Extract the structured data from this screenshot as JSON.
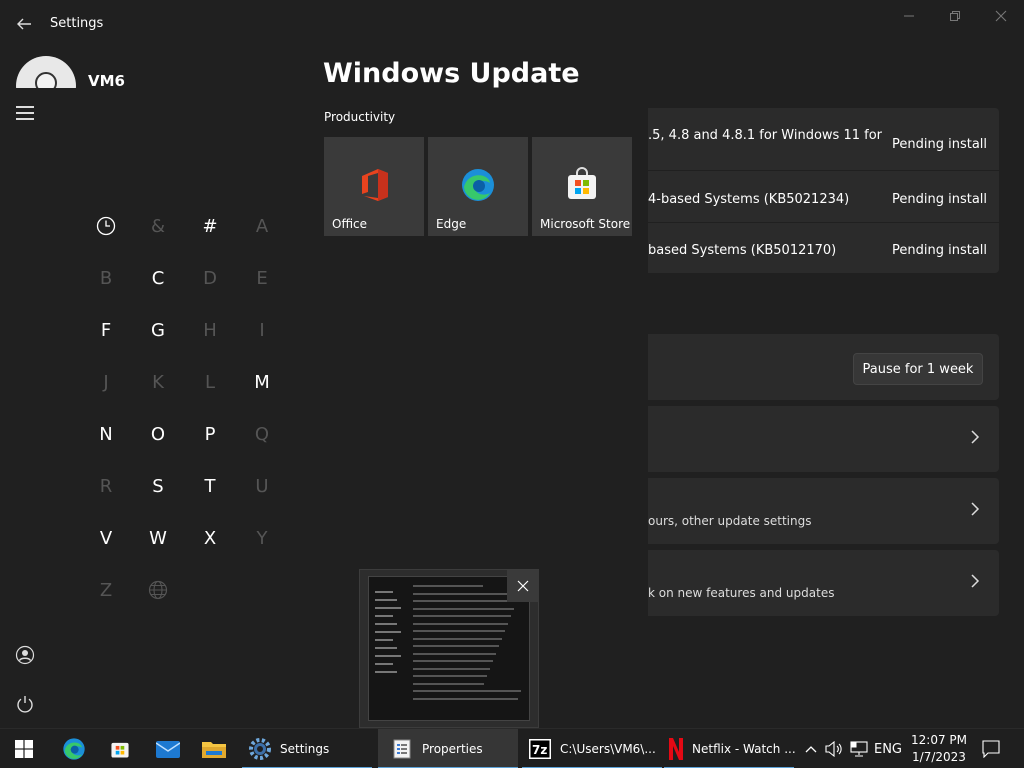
{
  "window": {
    "title": "Settings",
    "back_icon": "back-arrow-icon",
    "controls": [
      "minimize-icon",
      "maximize-icon",
      "close-icon"
    ]
  },
  "profile": {
    "name": "VM6"
  },
  "page": {
    "title": "Windows Update"
  },
  "updates": [
    {
      "name": ".5, 4.8 and 4.8.1 for Windows 11 for",
      "status": "Pending install"
    },
    {
      "name": "4-based Systems (KB5021234)",
      "status": "Pending install"
    },
    {
      "name": "based Systems (KB5012170)",
      "status": "Pending install"
    }
  ],
  "pause": {
    "label": "Pause for 1 week"
  },
  "cards": [
    {
      "subtitle": ""
    },
    {
      "subtitle": "ours, other update settings"
    },
    {
      "subtitle": "k on new features and updates"
    }
  ],
  "start_menu": {
    "group_label": "Productivity",
    "tiles": [
      {
        "label": "Office",
        "icon": "office-icon"
      },
      {
        "label": "Edge",
        "icon": "edge-icon"
      },
      {
        "label": "Microsoft Store",
        "icon": "microsoft-store-icon"
      }
    ],
    "letters": [
      {
        "c": "clock",
        "on": true
      },
      {
        "c": "&",
        "on": false
      },
      {
        "c": "#",
        "on": true
      },
      {
        "c": "A",
        "on": false
      },
      {
        "c": "B",
        "on": false
      },
      {
        "c": "C",
        "on": true
      },
      {
        "c": "D",
        "on": false
      },
      {
        "c": "E",
        "on": false
      },
      {
        "c": "F",
        "on": true
      },
      {
        "c": "G",
        "on": true
      },
      {
        "c": "H",
        "on": false
      },
      {
        "c": "I",
        "on": false
      },
      {
        "c": "J",
        "on": false
      },
      {
        "c": "K",
        "on": false
      },
      {
        "c": "L",
        "on": false
      },
      {
        "c": "M",
        "on": true
      },
      {
        "c": "N",
        "on": true
      },
      {
        "c": "O",
        "on": true
      },
      {
        "c": "P",
        "on": true
      },
      {
        "c": "Q",
        "on": false
      },
      {
        "c": "R",
        "on": false
      },
      {
        "c": "S",
        "on": true
      },
      {
        "c": "T",
        "on": true
      },
      {
        "c": "U",
        "on": false
      },
      {
        "c": "V",
        "on": true
      },
      {
        "c": "W",
        "on": true
      },
      {
        "c": "X",
        "on": true
      },
      {
        "c": "Y",
        "on": false
      },
      {
        "c": "Z",
        "on": false
      },
      {
        "c": "globe",
        "on": false
      }
    ]
  },
  "taskbar": {
    "items": [
      {
        "label": "",
        "icon": "start-windows-icon"
      },
      {
        "label": "",
        "icon": "edge-icon"
      },
      {
        "label": "",
        "icon": "microsoft-store-icon"
      },
      {
        "label": "",
        "icon": "mail-icon"
      },
      {
        "label": "",
        "icon": "file-explorer-icon"
      },
      {
        "label": "Settings",
        "icon": "settings-gear-icon"
      },
      {
        "label": "Properties",
        "icon": "properties-icon"
      },
      {
        "label": "C:\\Users\\VM6\\...",
        "icon": "7zip-icon"
      },
      {
        "label": "Netflix - Watch ...",
        "icon": "netflix-icon"
      }
    ],
    "language": "ENG",
    "time": "12:07 PM",
    "date": "1/7/2023"
  },
  "colors": {
    "accent": "#5da3d9",
    "background": "#202020",
    "card": "#2b2b2b",
    "netflix": "#e50914"
  }
}
